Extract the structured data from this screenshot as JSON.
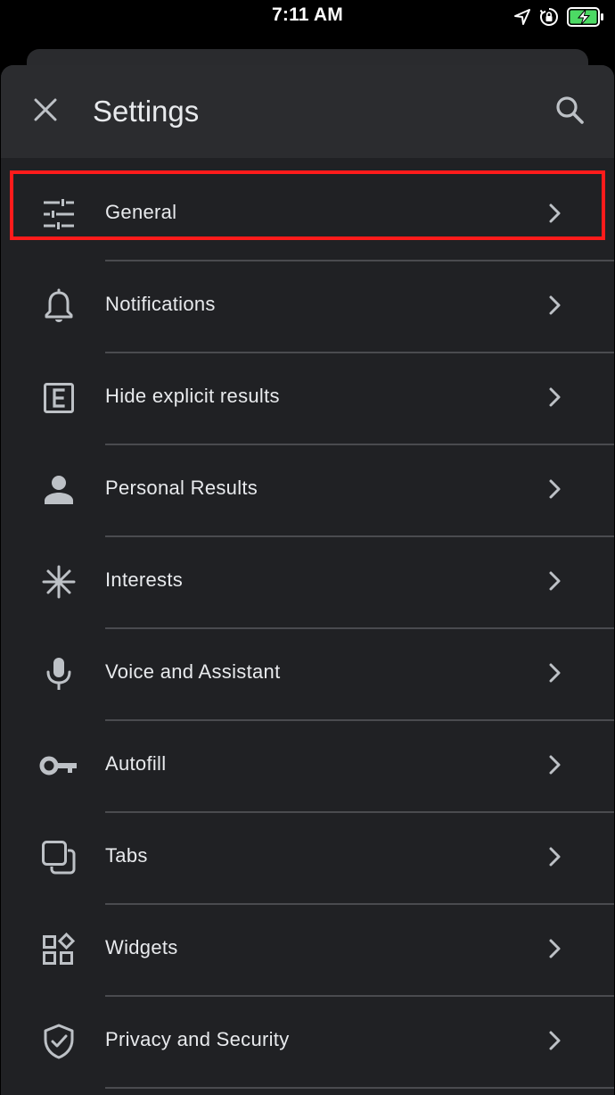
{
  "status_bar": {
    "time": "7:11 AM",
    "icons": [
      "location-arrow-icon",
      "orientation-lock-icon",
      "battery-charging-icon"
    ],
    "battery_color": "#4cd964"
  },
  "header": {
    "title": "Settings",
    "close_icon": "close-icon",
    "search_icon": "search-icon"
  },
  "colors": {
    "sheet_background": "#202124",
    "header_background": "#2b2c2f",
    "text": "#e8eaed",
    "icon": "#bdc1c6",
    "divider": "#4a4b4f",
    "highlight": "#ff1b1b"
  },
  "settings": {
    "items": [
      {
        "label": "General",
        "icon": "tune-sliders-icon",
        "highlighted": true
      },
      {
        "label": "Notifications",
        "icon": "bell-icon"
      },
      {
        "label": "Hide explicit results",
        "icon": "explicit-e-icon"
      },
      {
        "label": "Personal Results",
        "icon": "person-icon"
      },
      {
        "label": "Interests",
        "icon": "asterisk-icon"
      },
      {
        "label": "Voice and Assistant",
        "icon": "microphone-icon"
      },
      {
        "label": "Autofill",
        "icon": "key-icon"
      },
      {
        "label": "Tabs",
        "icon": "tabs-icon"
      },
      {
        "label": "Widgets",
        "icon": "widgets-icon"
      },
      {
        "label": "Privacy and Security",
        "icon": "shield-check-icon"
      }
    ]
  }
}
